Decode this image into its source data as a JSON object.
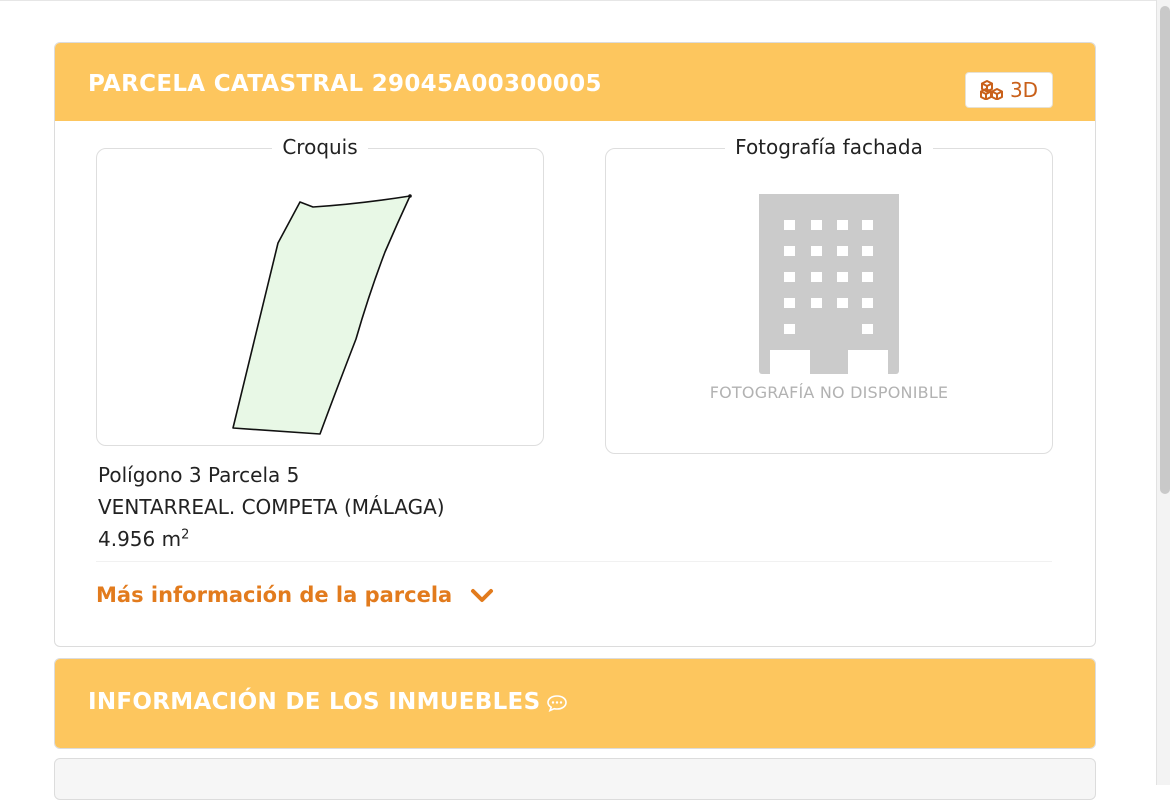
{
  "parcela": {
    "title": "PARCELA CATASTRAL 29045A00300005",
    "btn_3d_label": "3D",
    "croquis_legend": "Croquis",
    "foto_legend": "Fotografía fachada",
    "no_photo_text": "FOTOGRAFÍA NO DISPONIBLE",
    "poligono": "Polígono 3 Parcela 5",
    "localidad": "VENTARREAL. COMPETA (MÁLAGA)",
    "superficie": "4.956 m",
    "superficie_unit_exp": "2",
    "more_info": "Más información de la parcela"
  },
  "inmuebles": {
    "title": "INFORMACIÓN DE LOS INMUEBLES"
  },
  "icons": {
    "three_d": "cubes-icon",
    "building": "building-icon",
    "more": "chevron-down-icon",
    "comment": "chat-bubble-icon"
  },
  "colors": {
    "header_bg": "#fdc65e",
    "accent": "#e27b1d",
    "parcel_fill": "#e8f8e6"
  }
}
